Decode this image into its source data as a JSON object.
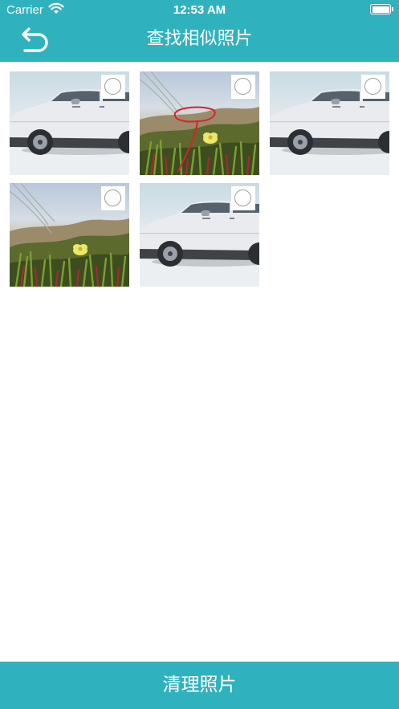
{
  "status_bar": {
    "carrier": "Carrier",
    "time": "12:53 AM"
  },
  "header": {
    "title": "查找相似照片",
    "back_icon": "back-arrow-icon"
  },
  "photos": [
    {
      "subject": "car",
      "selected": false
    },
    {
      "subject": "flower-annotated",
      "selected": false
    },
    {
      "subject": "car",
      "selected": false
    },
    {
      "subject": "flower",
      "selected": false
    },
    {
      "subject": "car",
      "selected": false
    }
  ],
  "footer": {
    "button_label": "清理照片"
  },
  "colors": {
    "accent": "#2fb2bd"
  }
}
